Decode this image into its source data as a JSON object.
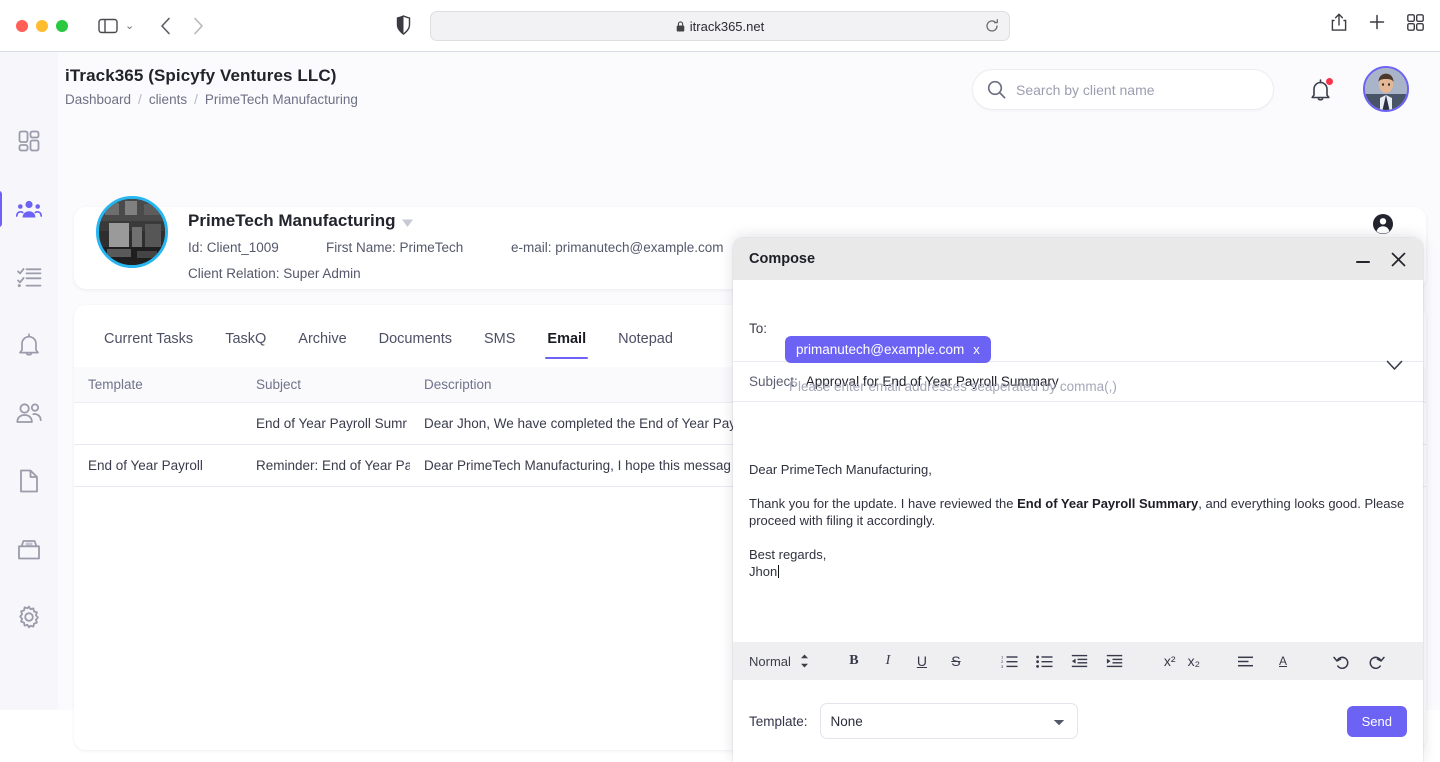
{
  "browser": {
    "url": "itrack365.net",
    "lock_icon": "lock-icon",
    "reload_icon": "reload-icon",
    "back_icon": "chevron-left-icon",
    "forward_icon": "chevron-right-icon",
    "sidebar_icon": "sidebar-toggle-icon",
    "shield_icon": "privacy-shield-icon",
    "share_icon": "share-icon",
    "newtab_icon": "plus-icon",
    "tabs_icon": "tab-overview-icon"
  },
  "sidebar": {
    "items": [
      {
        "name": "dashboard",
        "icon": "grid-dashboard-icon",
        "active": false
      },
      {
        "name": "clients",
        "icon": "clients-group-icon",
        "active": true
      },
      {
        "name": "tasks",
        "icon": "checklist-icon",
        "active": false
      },
      {
        "name": "notifications",
        "icon": "bell-icon",
        "active": false
      },
      {
        "name": "users",
        "icon": "users-icon",
        "active": false
      },
      {
        "name": "documents",
        "icon": "document-icon",
        "active": false
      },
      {
        "name": "archive",
        "icon": "archive-box-icon",
        "active": false
      },
      {
        "name": "settings",
        "icon": "gear-icon",
        "active": false
      }
    ]
  },
  "header": {
    "title": "iTrack365 (Spicyfy Ventures LLC)",
    "breadcrumb": [
      "Dashboard",
      "clients",
      "PrimeTech Manufacturing"
    ],
    "breadcrumb_separator": "/",
    "search": {
      "value": "",
      "placeholder": "Search by client name",
      "icon": "search-icon"
    },
    "notification_icon": "bell-icon",
    "notification_dot": true,
    "avatar": "user-avatar"
  },
  "client": {
    "name": "PrimeTech Manufacturing",
    "caret_icon": "chevron-down-icon",
    "id_label": "Id: Client_1009",
    "first_name_label": "First Name: PrimeTech",
    "email_label": "e-mail: primanutech@example.com",
    "relation_label": "Client Relation: Super Admin",
    "account_icon": "account-circle-icon"
  },
  "tabs": [
    {
      "label": "Current Tasks",
      "active": false
    },
    {
      "label": "TaskQ",
      "active": false
    },
    {
      "label": "Archive",
      "active": false
    },
    {
      "label": "Documents",
      "active": false
    },
    {
      "label": "SMS",
      "active": false
    },
    {
      "label": "Email",
      "active": true
    },
    {
      "label": "Notepad",
      "active": false
    }
  ],
  "table": {
    "columns": [
      "Template",
      "Subject",
      "Description"
    ],
    "rows": [
      {
        "template": "",
        "subject": "End of Year Payroll Sumr",
        "description": "Dear Jhon, We have completed the End of Year Pay"
      },
      {
        "template": "End of Year Payroll",
        "subject": "Reminder: End of Year Pa",
        "description": "Dear PrimeTech Manufacturing, I hope this messag"
      }
    ]
  },
  "compose": {
    "title": "Compose",
    "minimize_icon": "minimize-icon",
    "close_icon": "close-icon",
    "to_label": "To:",
    "recipient_chip": "primanutech@example.com",
    "chip_remove": "x",
    "to_placeholder": "Please enter email addresses seaperated by comma(,)",
    "expand_icon": "chevron-down-icon",
    "subject_label": "Subject:",
    "subject_value": "Approval for End of Year Payroll Summary",
    "body": {
      "line1": "Dear PrimeTech Manufacturing,",
      "line2_before": "Thank you for the update. I have reviewed the ",
      "line2_bold": "End of Year Payroll Summary",
      "line2_after": ", and everything looks good. Please proceed with filing it accordingly.",
      "line3": "Best regards,",
      "line4": "Jhon"
    },
    "toolbar": {
      "style_label": "Normal",
      "style_caret_icon": "updown-arrows-icon",
      "buttons": [
        {
          "name": "bold-button",
          "glyph": "B",
          "icon": "bold-icon"
        },
        {
          "name": "italic-button",
          "glyph": "I",
          "icon": "italic-icon"
        },
        {
          "name": "underline-button",
          "glyph": "U",
          "icon": "underline-icon"
        },
        {
          "name": "strike-button",
          "glyph": "S",
          "icon": "strikethrough-icon"
        },
        {
          "name": "ordered-list-button",
          "glyph": "",
          "icon": "ordered-list-icon"
        },
        {
          "name": "bullet-list-button",
          "glyph": "",
          "icon": "bullet-list-icon"
        },
        {
          "name": "outdent-button",
          "glyph": "",
          "icon": "outdent-icon"
        },
        {
          "name": "indent-button",
          "glyph": "",
          "icon": "indent-icon"
        },
        {
          "name": "superscript-button",
          "glyph": "x²",
          "icon": "superscript-icon"
        },
        {
          "name": "subscript-button",
          "glyph": "x₂",
          "icon": "subscript-icon"
        },
        {
          "name": "align-button",
          "glyph": "",
          "icon": "align-left-icon"
        },
        {
          "name": "font-color-button",
          "glyph": "A",
          "icon": "font-color-icon"
        },
        {
          "name": "undo-button",
          "glyph": "",
          "icon": "undo-icon"
        },
        {
          "name": "redo-button",
          "glyph": "",
          "icon": "redo-icon"
        },
        {
          "name": "attach-button",
          "glyph": "",
          "icon": "paperclip-icon"
        }
      ]
    },
    "template_label": "Template:",
    "template_value": "None",
    "template_options": [
      "None"
    ],
    "send_label": "Send"
  },
  "colors": {
    "accent": "#6c63f5",
    "client_ring": "#27b6f0",
    "notification_dot": "#f5354a",
    "compose_header_bg": "#e9e9ea",
    "toolbar_bg": "#efeff1",
    "app_bg": "#fbfbfd"
  }
}
